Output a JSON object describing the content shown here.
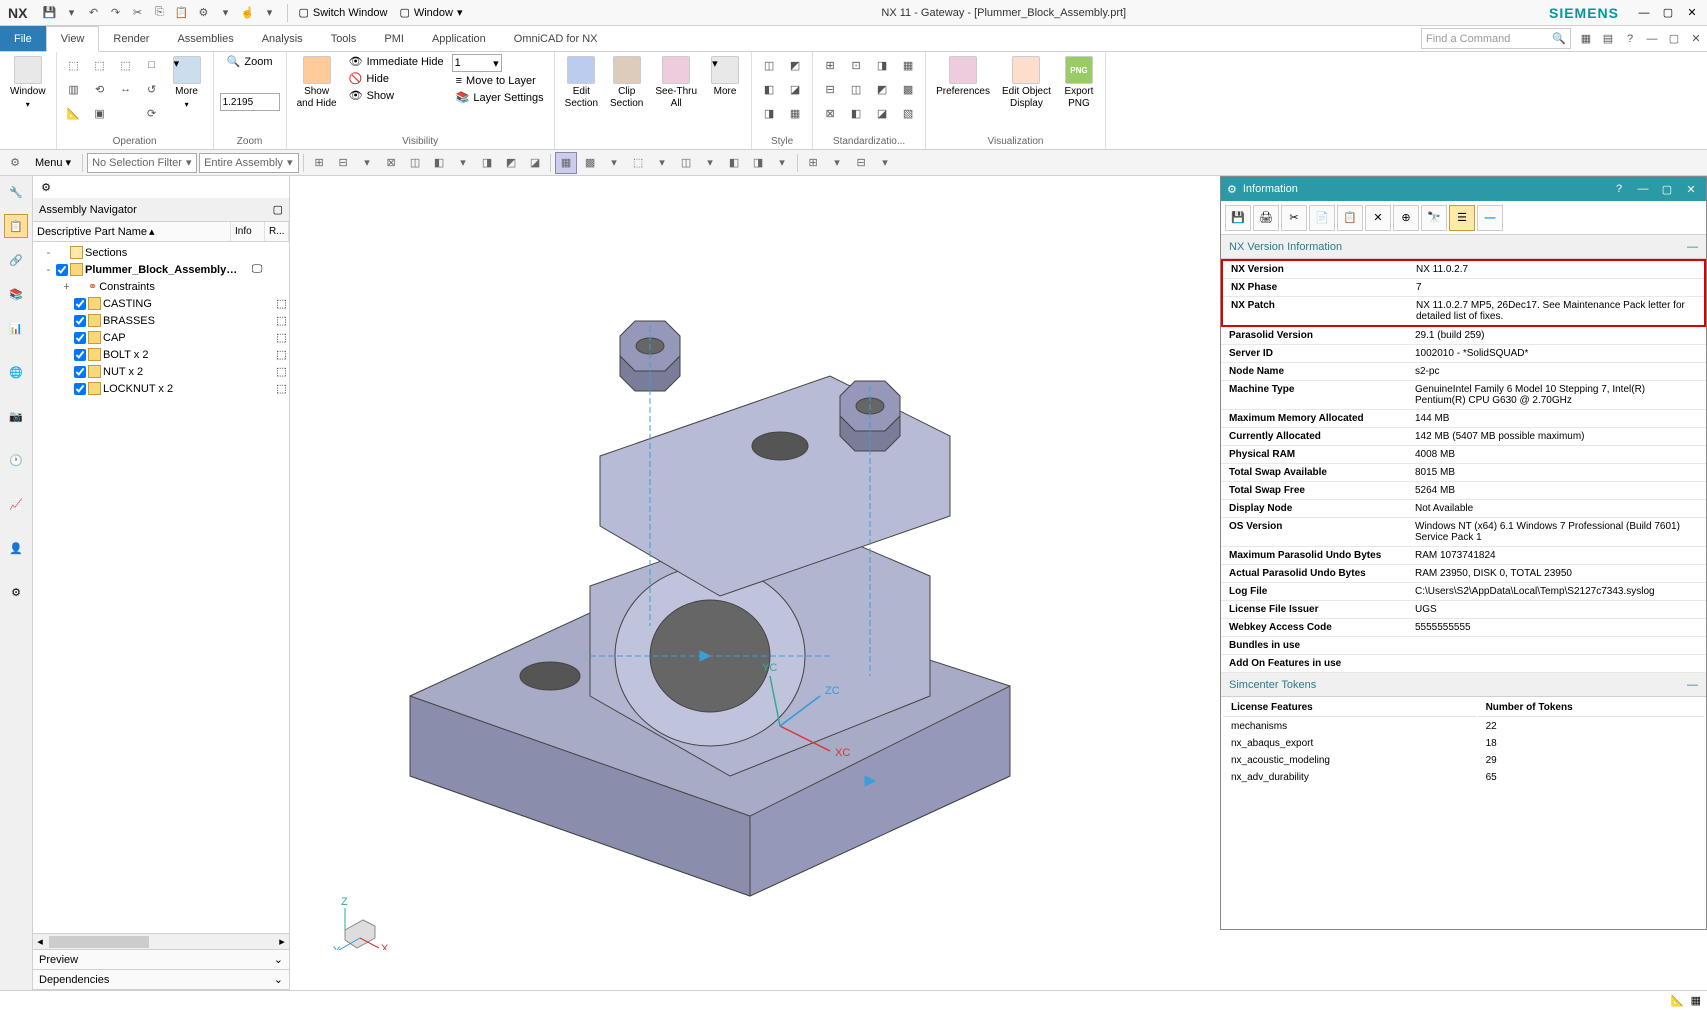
{
  "title": "NX 11 - Gateway - [Plummer_Block_Assembly.prt]",
  "brand": "SIEMENS",
  "nx_logo": "NX",
  "qat": {
    "switch_window": "Switch Window",
    "window": "Window"
  },
  "ribbon_tabs": {
    "file": "File",
    "view": "View",
    "render": "Render",
    "assemblies": "Assemblies",
    "analysis": "Analysis",
    "tools": "Tools",
    "pmi": "PMI",
    "application": "Application",
    "omnicad": "OmniCAD for NX",
    "search_placeholder": "Find a Command"
  },
  "ribbon": {
    "window_grp": {
      "window": "Window",
      "label": ""
    },
    "operation": {
      "more": "More",
      "label": "Operation"
    },
    "zoom": {
      "zoom": "Zoom",
      "value": "1.2195",
      "label": "Zoom"
    },
    "showhide": {
      "show_and_hide": "Show\nand Hide",
      "immediate_hide": "Immediate Hide",
      "hide": "Hide",
      "show": "Show",
      "combo1": "1"
    },
    "visibility": {
      "move_to_layer": "Move to Layer",
      "layer_settings": "Layer Settings",
      "label": "Visibility"
    },
    "edit_section": "Edit\nSection",
    "clip_section": "Clip\nSection",
    "see_thru": "See-Thru\nAll",
    "more2": "More",
    "style": "Style",
    "standardization": "Standardizatio...",
    "preferences": "Preferences",
    "edit_obj_display": "Edit Object\nDisplay",
    "export_png": "Export\nPNG",
    "visualization": "Visualization"
  },
  "tbrow": {
    "menu": "Menu",
    "filter1": "No Selection Filter",
    "filter2": "Entire Assembly"
  },
  "nav": {
    "gear_title": "",
    "title": "Assembly Navigator",
    "cols": {
      "name": "Descriptive Part Name",
      "info": "Info",
      "r": "R..."
    },
    "tree": [
      {
        "level": 0,
        "exp": "-",
        "chk": false,
        "icon": "folder",
        "label": "Sections",
        "bold": false
      },
      {
        "level": 0,
        "exp": "-",
        "chk": true,
        "icon": "asm",
        "label": "Plummer_Block_Assembly (O...",
        "bold": true,
        "info_icon": true
      },
      {
        "level": 1,
        "exp": "+",
        "chk": false,
        "icon": "constr",
        "label": "Constraints",
        "bold": false
      },
      {
        "level": 1,
        "exp": "",
        "chk": true,
        "icon": "part",
        "label": "CASTING",
        "bold": false,
        "r_dot": true
      },
      {
        "level": 1,
        "exp": "",
        "chk": true,
        "icon": "part",
        "label": "BRASSES",
        "bold": false,
        "r_dot": true
      },
      {
        "level": 1,
        "exp": "",
        "chk": true,
        "icon": "part",
        "label": "CAP",
        "bold": false,
        "r_dot": true
      },
      {
        "level": 1,
        "exp": "",
        "chk": true,
        "icon": "part",
        "label": "BOLT x 2",
        "bold": false,
        "r_dot": true
      },
      {
        "level": 1,
        "exp": "",
        "chk": true,
        "icon": "part",
        "label": "NUT x 2",
        "bold": false,
        "r_dot": true
      },
      {
        "level": 1,
        "exp": "",
        "chk": true,
        "icon": "part",
        "label": "LOCKNUT x 2",
        "bold": false,
        "r_dot": true
      }
    ],
    "preview": "Preview",
    "dependencies": "Dependencies"
  },
  "info_dlg": {
    "title": "Information",
    "section": "NX Version Information",
    "highlighted_rows": [
      {
        "k": "NX Version",
        "v": "NX 11.0.2.7"
      },
      {
        "k": "NX Phase",
        "v": "7"
      },
      {
        "k": "NX Patch",
        "v": "NX 11.0.2.7 MP5, 26Dec17. See Maintenance Pack letter for detailed list of fixes."
      }
    ],
    "rows": [
      {
        "k": "Parasolid Version",
        "v": "29.1 (build 259)"
      },
      {
        "k": "Server ID",
        "v": "1002010 - *SolidSQUAD*"
      },
      {
        "k": "Node Name",
        "v": "s2-pc"
      },
      {
        "k": "Machine Type",
        "v": "GenuineIntel Family 6 Model 10 Stepping 7, Intel(R) Pentium(R) CPU G630 @ 2.70GHz"
      },
      {
        "k": "Maximum Memory Allocated",
        "v": "144 MB"
      },
      {
        "k": "Currently Allocated",
        "v": "142 MB (5407 MB possible maximum)"
      },
      {
        "k": "Physical RAM",
        "v": "4008 MB"
      },
      {
        "k": "Total Swap Available",
        "v": "8015 MB"
      },
      {
        "k": "Total Swap Free",
        "v": "5264 MB"
      },
      {
        "k": "Display Node",
        "v": "Not Available"
      },
      {
        "k": "OS Version",
        "v": "Windows NT (x64) 6.1 Windows 7 Professional (Build 7601) Service Pack 1"
      },
      {
        "k": "Maximum Parasolid Undo Bytes",
        "v": "RAM 1073741824"
      },
      {
        "k": "Actual Parasolid Undo Bytes",
        "v": "RAM 23950, DISK 0, TOTAL 23950"
      },
      {
        "k": "Log File",
        "v": "C:\\Users\\S2\\AppData\\Local\\Temp\\S2127c7343.syslog"
      },
      {
        "k": "License File Issuer",
        "v": "UGS"
      },
      {
        "k": "Webkey Access Code",
        "v": "5555555555"
      },
      {
        "k": "Bundles in use",
        "v": ""
      },
      {
        "k": "Add On Features in use",
        "v": ""
      }
    ],
    "tokens_section": "Simcenter Tokens",
    "tokens_cols": {
      "feat": "License Features",
      "num": "Number of Tokens"
    },
    "tokens": [
      {
        "f": "mechanisms",
        "n": "22"
      },
      {
        "f": "nx_abaqus_export",
        "n": "18"
      },
      {
        "f": "nx_acoustic_modeling",
        "n": "29"
      },
      {
        "f": "nx_adv_durability",
        "n": "65"
      }
    ]
  }
}
